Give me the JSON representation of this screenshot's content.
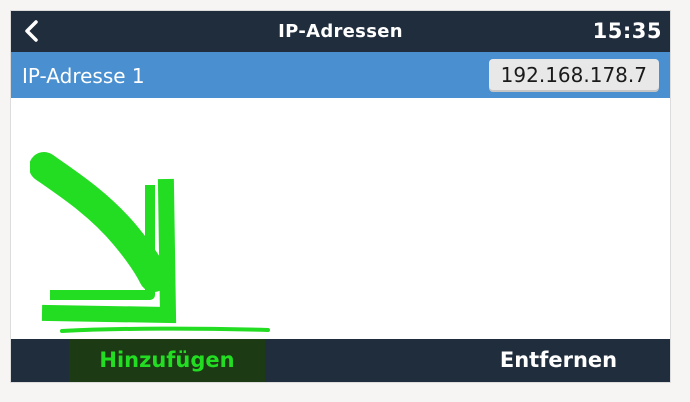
{
  "header": {
    "back_icon": "chevron-left-icon",
    "title": "IP-Adressen",
    "clock": "15:35"
  },
  "list": {
    "items": [
      {
        "label": "IP-Adresse 1",
        "value": "192.168.178.7"
      }
    ]
  },
  "footer": {
    "add_label": "Hinzufügen",
    "remove_label": "Entfernen"
  },
  "annotation": {
    "type": "hand-drawn-arrow",
    "color": "#22dd22"
  },
  "colors": {
    "titlebar": "#1f2d3d",
    "selected_row": "#4a90d0",
    "highlight": "#22dd22"
  }
}
